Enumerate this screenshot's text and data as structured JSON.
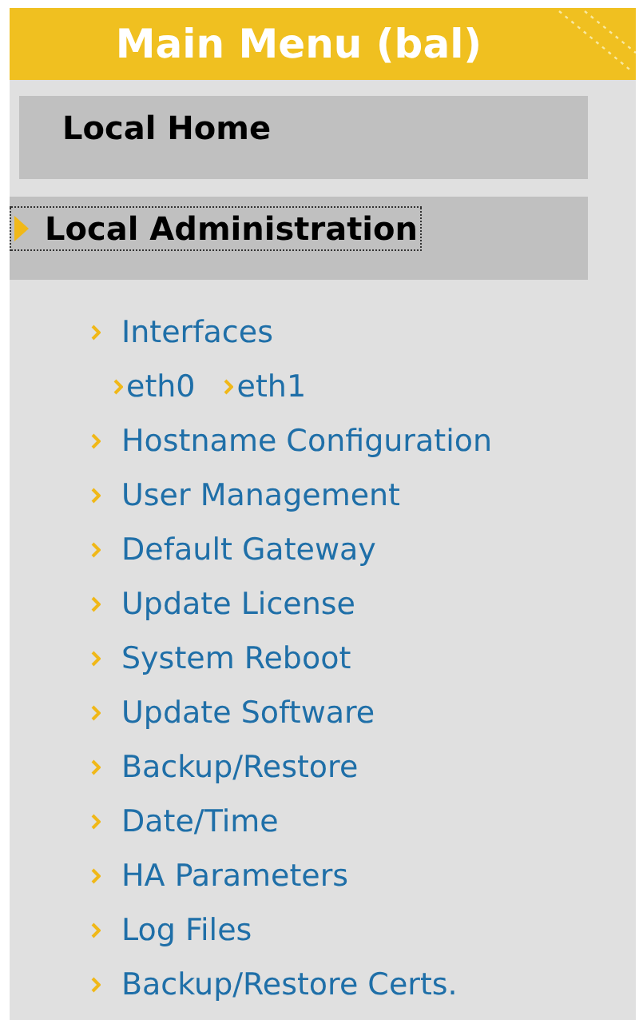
{
  "header": {
    "title": "Main Menu (bal)"
  },
  "sections": [
    {
      "label": "Local Home",
      "expanded": false,
      "focused": false
    },
    {
      "label": "Local Administration",
      "expanded": true,
      "focused": true,
      "items": [
        {
          "label": "Interfaces",
          "children": [
            {
              "label": "eth0"
            },
            {
              "label": "eth1"
            }
          ]
        },
        {
          "label": "Hostname Configuration"
        },
        {
          "label": "User Management"
        },
        {
          "label": "Default Gateway"
        },
        {
          "label": "Update License"
        },
        {
          "label": "System Reboot"
        },
        {
          "label": "Update Software"
        },
        {
          "label": "Backup/Restore"
        },
        {
          "label": "Date/Time"
        },
        {
          "label": "HA Parameters"
        },
        {
          "label": "Log Files"
        },
        {
          "label": "Backup/Restore Certs."
        }
      ]
    }
  ]
}
